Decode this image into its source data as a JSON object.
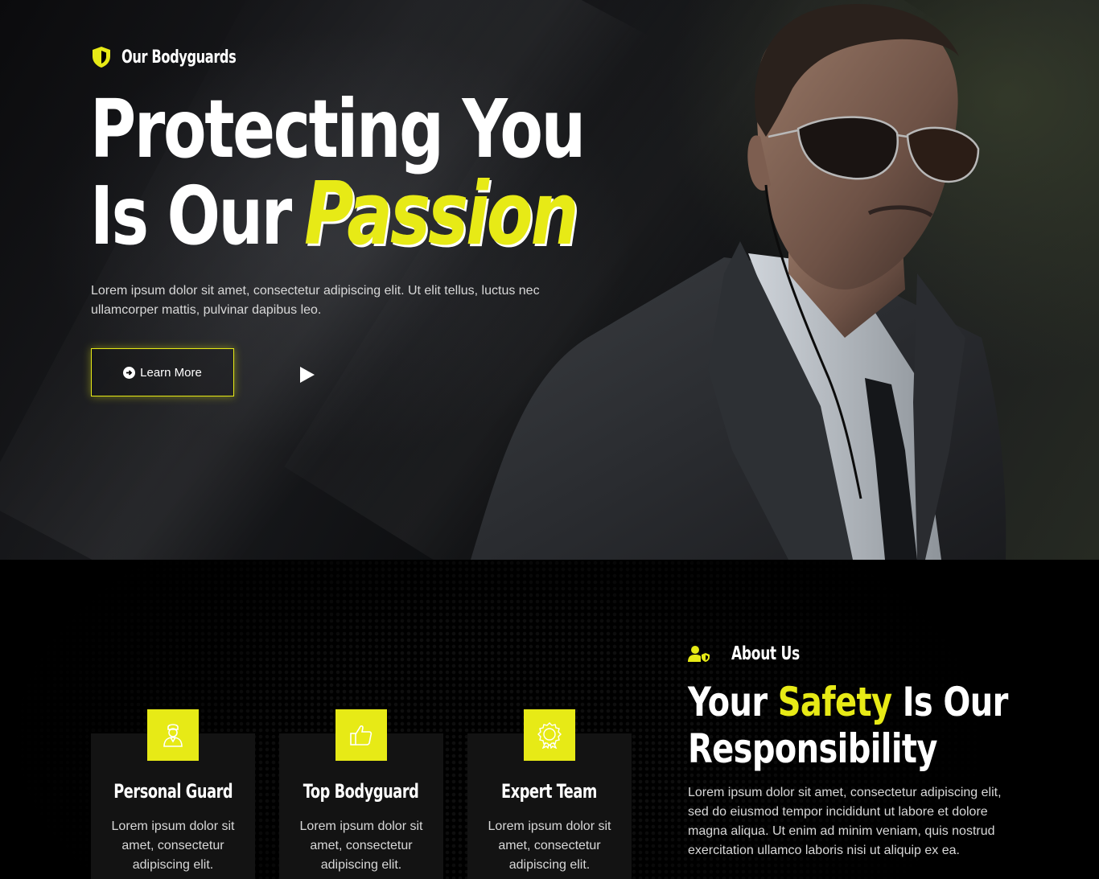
{
  "hero": {
    "eyebrow": "Our Bodyguards",
    "headline_line1": "Protecting You",
    "headline_line2_prefix": "Is Our",
    "headline_line2_accent": "Passion",
    "description": "Lorem ipsum dolor sit amet, consectetur adipiscing elit. Ut elit tellus, luctus nec ullamcorper mattis, pulvinar dapibus leo.",
    "learn_more_label": "Learn More"
  },
  "features": [
    {
      "title": "Personal Guard",
      "text": "Lorem ipsum dolor sit amet, consectetur adipiscing elit.",
      "icon": "user-guard-icon"
    },
    {
      "title": "Top Bodyguard",
      "text": "Lorem ipsum dolor sit amet, consectetur adipiscing elit.",
      "icon": "thumbs-up-icon"
    },
    {
      "title": "Expert Team",
      "text": "Lorem ipsum dolor sit amet, consectetur adipiscing elit.",
      "icon": "award-badge-icon"
    }
  ],
  "about": {
    "eyebrow": "About Us",
    "title_prefix": "Your",
    "title_accent": "Safety",
    "title_suffix": "Is Our",
    "title_line2": "Responsibility",
    "description": "Lorem ipsum dolor sit amet, consectetur adipiscing elit, sed do eiusmod tempor incididunt ut labore et dolore magna aliqua. Ut enim ad minim veniam, quis nostrud exercitation ullamco laboris nisi ut aliquip ex ea."
  },
  "colors": {
    "accent": "#e7ea16",
    "background": "#000000",
    "card": "#131313"
  }
}
